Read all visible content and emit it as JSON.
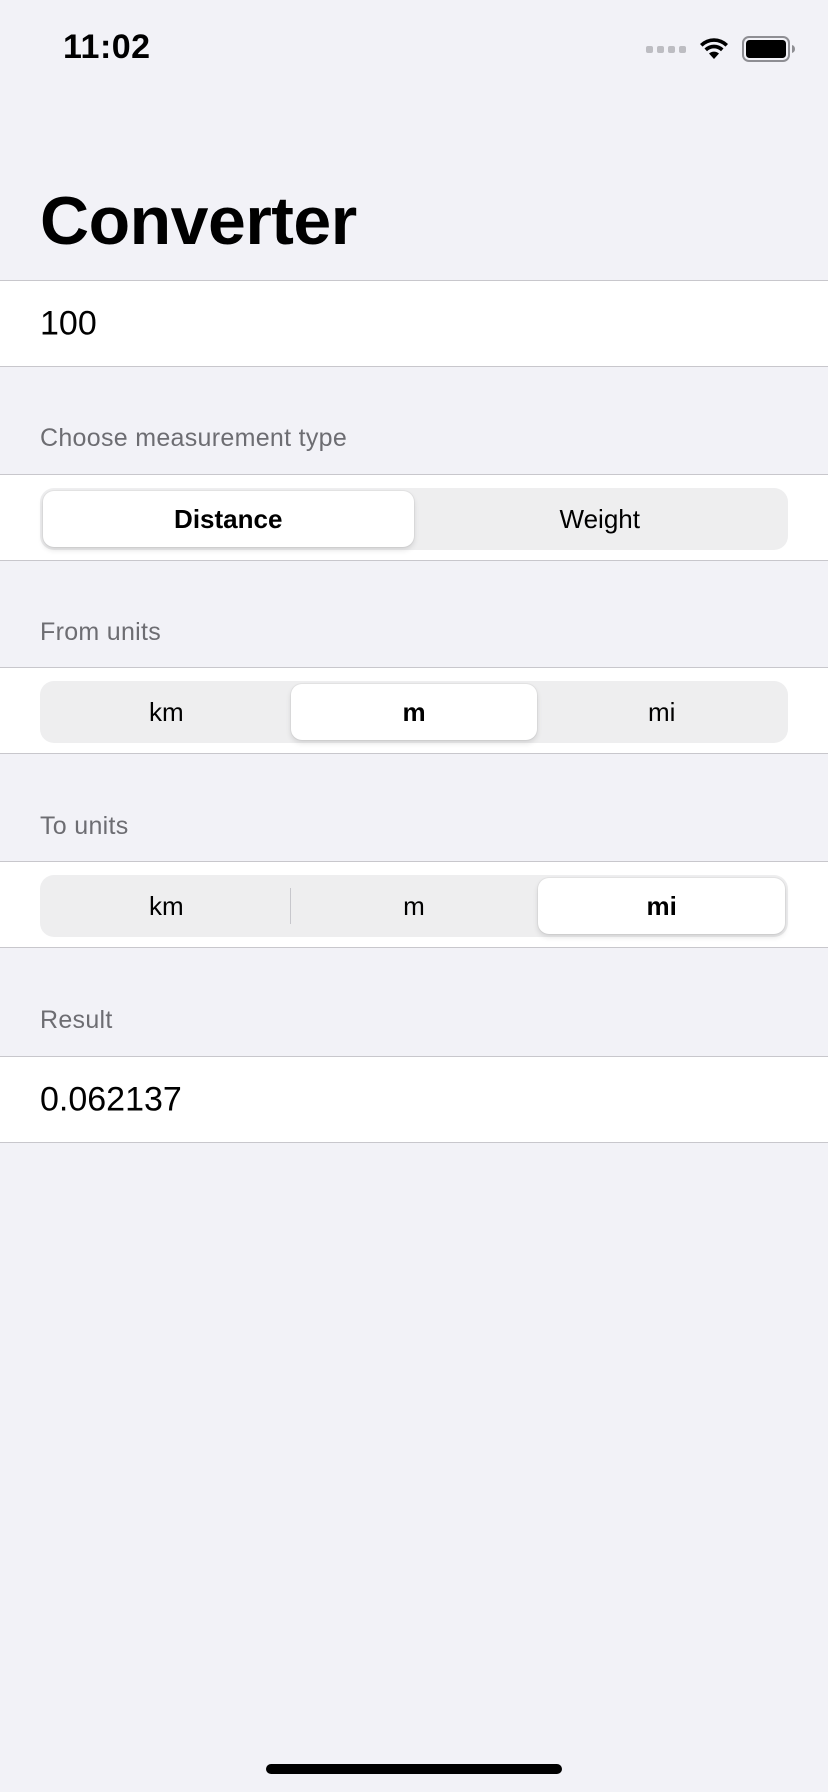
{
  "status_bar": {
    "time": "11:02"
  },
  "title": "Converter",
  "input": {
    "value": "100"
  },
  "measurement": {
    "header": "Choose measurement type",
    "options": [
      "Distance",
      "Weight"
    ],
    "selected": "Distance"
  },
  "from_units": {
    "header": "From units",
    "options": [
      "km",
      "m",
      "mi"
    ],
    "selected": "m"
  },
  "to_units": {
    "header": "To units",
    "options": [
      "km",
      "m",
      "mi"
    ],
    "selected": "mi"
  },
  "result": {
    "header": "Result",
    "value": "0.062137"
  },
  "colors": {
    "background": "#f2f2f7",
    "cell": "#ffffff",
    "header_text": "#6d6d72",
    "segment_track": "#eeeeef"
  }
}
